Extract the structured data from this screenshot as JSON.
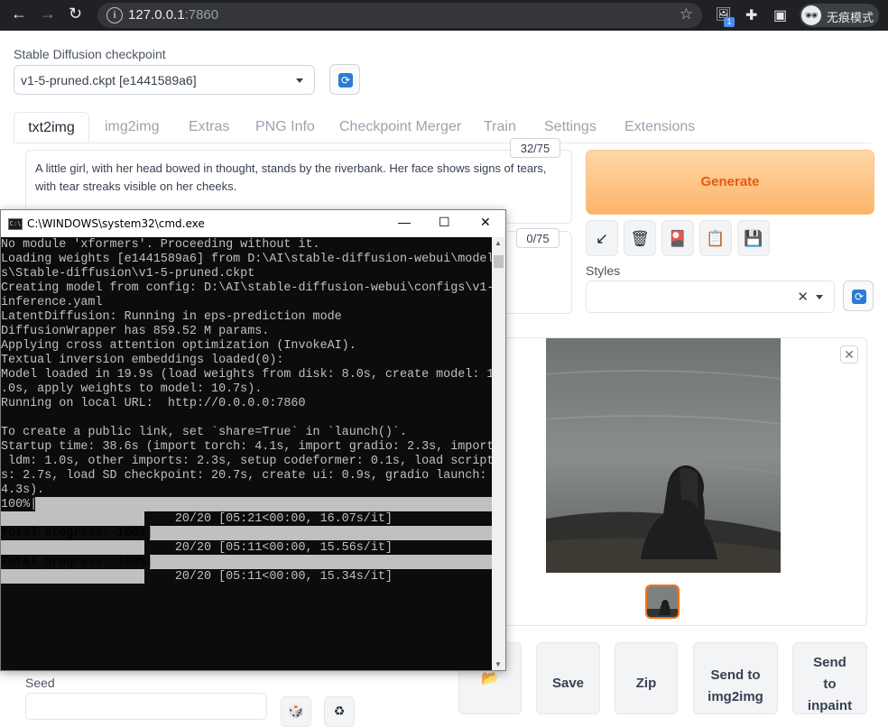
{
  "browser": {
    "back": "←",
    "forward": "→",
    "reload": "↻",
    "info": "i",
    "url_host": "127.0.0.1",
    "url_port": ":7860",
    "star": "☆",
    "ext_icon": "🖼",
    "ext_badge": "1",
    "puzzle": "✚",
    "sidebar": "▣",
    "incognito_avatar": "🕶",
    "incognito_label": "无痕模式"
  },
  "checkpoint": {
    "label": "Stable Diffusion checkpoint",
    "value": "v1-5-pruned.ckpt [e1441589a6]",
    "refresh": "⟳"
  },
  "tabs": [
    "txt2img",
    "img2img",
    "Extras",
    "PNG Info",
    "Checkpoint Merger",
    "Train",
    "Settings",
    "Extensions"
  ],
  "prompt": {
    "text": "A little girl, with her head bowed in thought, stands by the riverbank. Her face shows signs of tears, with tear streaks visible on her cheeks.",
    "token_count": "32/75",
    "neg_token_count": "0/75"
  },
  "generate_label": "Generate",
  "tools": [
    "↙",
    "🗑",
    "🎴",
    "📋",
    "💾"
  ],
  "styles": {
    "label": "Styles",
    "clear": "✕",
    "refresh": "⟳"
  },
  "gallery": {
    "close": "✕"
  },
  "output_buttons": {
    "folder": "📂",
    "save": "Save",
    "zip": "Zip",
    "send_img2img_1": "Send to",
    "send_img2img_2": "img2img",
    "send_inpaint_1": "Send",
    "send_inpaint_2": "to",
    "send_inpaint_3": "inpaint"
  },
  "seed": {
    "label": "Seed",
    "btn1": "🎲",
    "btn2": "♻"
  },
  "cmd": {
    "title": "C:\\WINDOWS\\system32\\cmd.exe",
    "icon": "C:\\",
    "minimize": "—",
    "maximize": "☐",
    "close": "✕",
    "lines": [
      "No module 'xformers'. Proceeding without it.",
      "Loading weights [e1441589a6] from D:\\AI\\stable-diffusion-webui\\model",
      "s\\Stable-diffusion\\v1-5-pruned.ckpt",
      "Creating model from config: D:\\AI\\stable-diffusion-webui\\configs\\v1-",
      "inference.yaml",
      "LatentDiffusion: Running in eps-prediction mode",
      "DiffusionWrapper has 859.52 M params.",
      "Applying cross attention optimization (InvokeAI).",
      "Textual inversion embeddings loaded(0):",
      "Model loaded in 19.9s (load weights from disk: 8.0s, create model: 1",
      ".0s, apply weights to model: 10.7s).",
      "Running on local URL:  http://0.0.0.0:7860",
      "",
      "To create a public link, set `share=True` in `launch()`.",
      "Startup time: 38.6s (import torch: 4.1s, import gradio: 2.3s, import",
      " ldm: 1.0s, other imports: 2.3s, setup codeformer: 0.1s, load script",
      "s: 2.7s, load SD checkpoint: 20.7s, create ui: 0.9s, gradio launch:",
      "4.3s).",
      "100%|",
      "                        20/20 [05:21<00:00, 16.07s/it]",
      "Total progress: 100%|",
      "                        20/20 [05:11<00:00, 15.56s/it]",
      "Total progress: 100%|",
      "                        20/20 [05:11<00:00, 15.34s/it]"
    ]
  }
}
